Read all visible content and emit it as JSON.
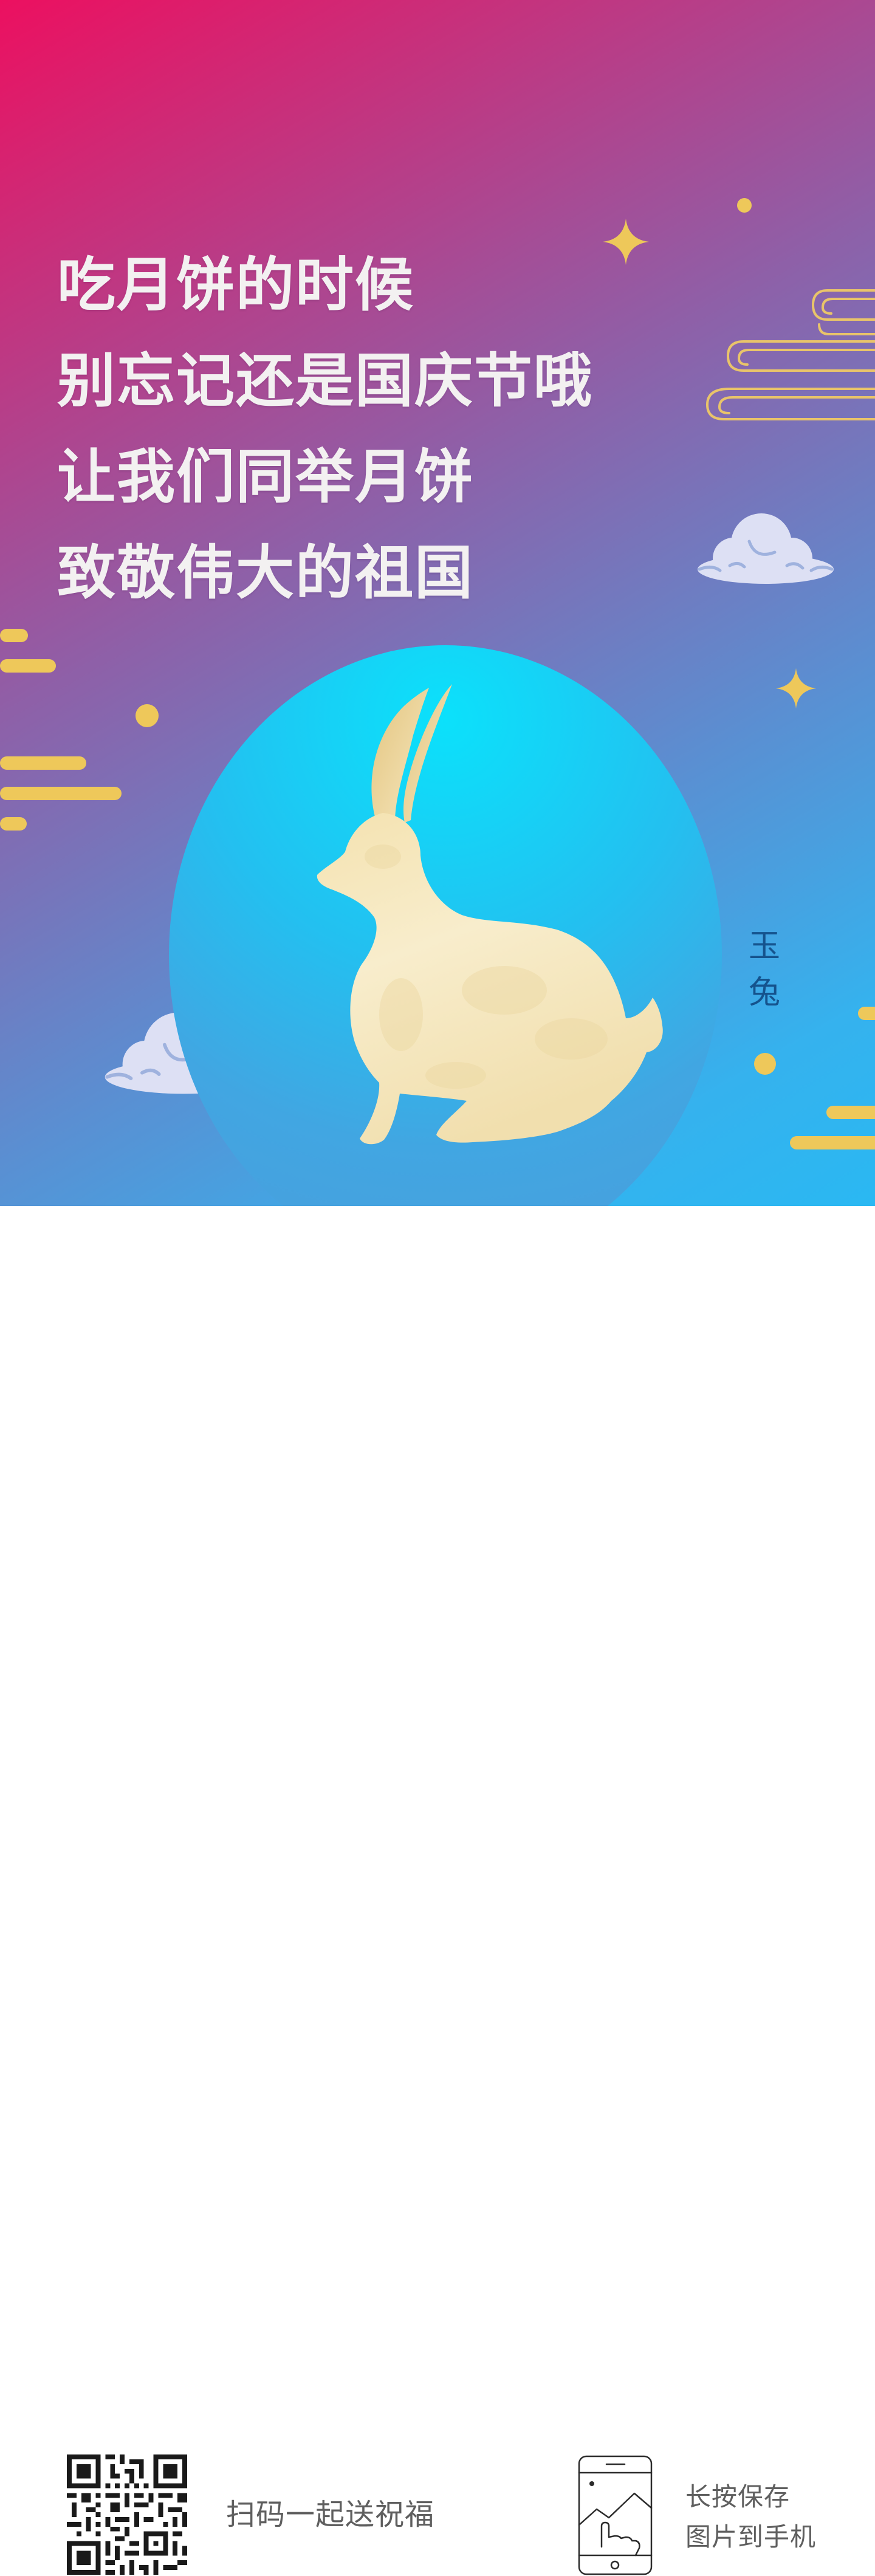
{
  "headline": {
    "lines": [
      "吃月饼的时候",
      "别忘记还是国庆节哦",
      "让我们同举月饼",
      "致敬伟大的祖国"
    ]
  },
  "illustration": {
    "label": "玉兔",
    "rabbit": "jade-rabbit-silhouette",
    "moon": "moon-disc"
  },
  "footer": {
    "scan_label": "扫码一起送祝福",
    "save_hint_line1": "长按保存",
    "save_hint_line2": "图片到手机"
  },
  "colors": {
    "gradient_top": "#ec1060",
    "gradient_bottom": "#2ab8f2",
    "gold": "#eec85a",
    "cloud": "#dde0f4",
    "headline_text": "#f3f1f1",
    "label_text": "#15538d",
    "footer_text": "#5f5f5f"
  }
}
